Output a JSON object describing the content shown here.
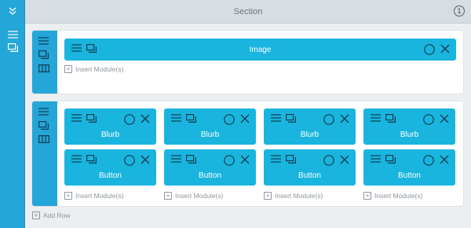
{
  "section": {
    "title": "Section",
    "count": "1"
  },
  "row1": {
    "module": {
      "label": "Image"
    },
    "insert_label": "Insert Module(s)"
  },
  "row2": {
    "columns": [
      {
        "top_label": "Blurb",
        "bottom_label": "Button",
        "insert_label": "Insert Module(s)"
      },
      {
        "top_label": "Blurb",
        "bottom_label": "Button",
        "insert_label": "Insert Module(s)"
      },
      {
        "top_label": "Blurb",
        "bottom_label": "Button",
        "insert_label": "Insert Module(s)"
      },
      {
        "top_label": "Blurb",
        "bottom_label": "Button",
        "insert_label": "Insert Module(s)"
      }
    ]
  },
  "add_row_label": "Add Row",
  "colors": {
    "sidebar": "#24a6d8",
    "module": "#19b5de",
    "header": "#d8dde2",
    "body": "#eceff1"
  },
  "icons": [
    "chevron-double-down-icon",
    "hamburger-icon",
    "duplicate-icon",
    "columns-icon",
    "settings-circle-icon",
    "close-icon",
    "plus-icon"
  ]
}
